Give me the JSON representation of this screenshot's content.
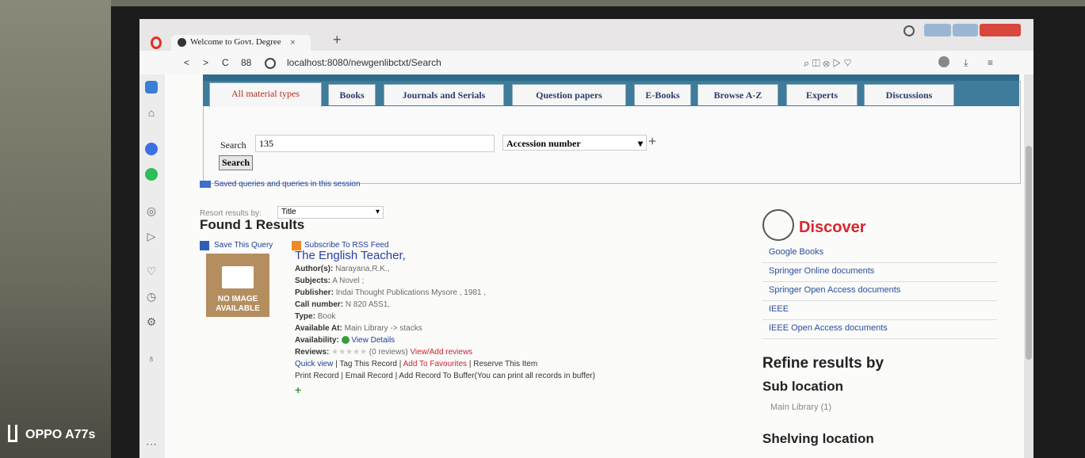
{
  "browser": {
    "tab_title": "Welcome to Govt. Degree",
    "tab_close": "×",
    "new_tab": "+",
    "url": "localhost:8080/newgenlibctxt/Search",
    "nav_back": "<",
    "nav_forward": ">",
    "reload": "C",
    "grid": "88"
  },
  "search": {
    "tabs": [
      "All material types",
      "Books",
      "Journals and Serials",
      "Question papers",
      "E-Books",
      "Browse A-Z",
      "Experts",
      "Discussions"
    ],
    "search_label": "Search",
    "search_value": "135",
    "field_select": "Accession number",
    "add_symbol": "+",
    "search_button": "Search",
    "saved_queries": "Saved queries and queries in this session"
  },
  "results": {
    "resort_label": "Resort results by:",
    "resort_value": "Title",
    "found": "Found 1 Results",
    "save_query": "Save This Query",
    "subscribe": "Subscribe To RSS Feed",
    "no_image": [
      "NO IMAGE",
      "AVAILABLE"
    ],
    "title": "The English Teacher,",
    "author_label": "Author(s):",
    "author": "Narayana,R.K.,",
    "subjects_label": "Subjects:",
    "subjects": "A Novel ;",
    "publisher_label": "Publisher:",
    "publisher": "Indai Thought Publications Mysore , 1981 ,",
    "call_label": "Call number:",
    "call": "N 820 A5S1,",
    "type_label": "Type:",
    "type": "Book",
    "available_label": "Available At:",
    "available": "Main Library -> stacks",
    "availability_label": "Availability:",
    "view_details": "View Details",
    "reviews_label": "Reviews:",
    "reviews_count": "(0 reviews)",
    "view_add_reviews": "View/Add reviews",
    "actions_row1": [
      "Quick view",
      "Tag This Record",
      "Add To Favourites",
      "Reserve This Item"
    ],
    "actions_row2": [
      "Print Record",
      "Email Record",
      "Add Record To Buffer(You can print all records in buffer)"
    ],
    "plus": "+",
    "stars": "★★★★★",
    "separator": "|"
  },
  "discover": {
    "title": "Discover",
    "links": [
      "Google Books",
      "Springer Online documents",
      "Springer Open Access documents",
      "IEEE",
      "IEEE Open Access documents"
    ],
    "refine": "Refine results by",
    "sub_location": "Sub location",
    "sub_location_item": "Main Library (1)",
    "shelving": "Shelving location"
  },
  "overlay": {
    "watermark": "OPPO A77s"
  }
}
